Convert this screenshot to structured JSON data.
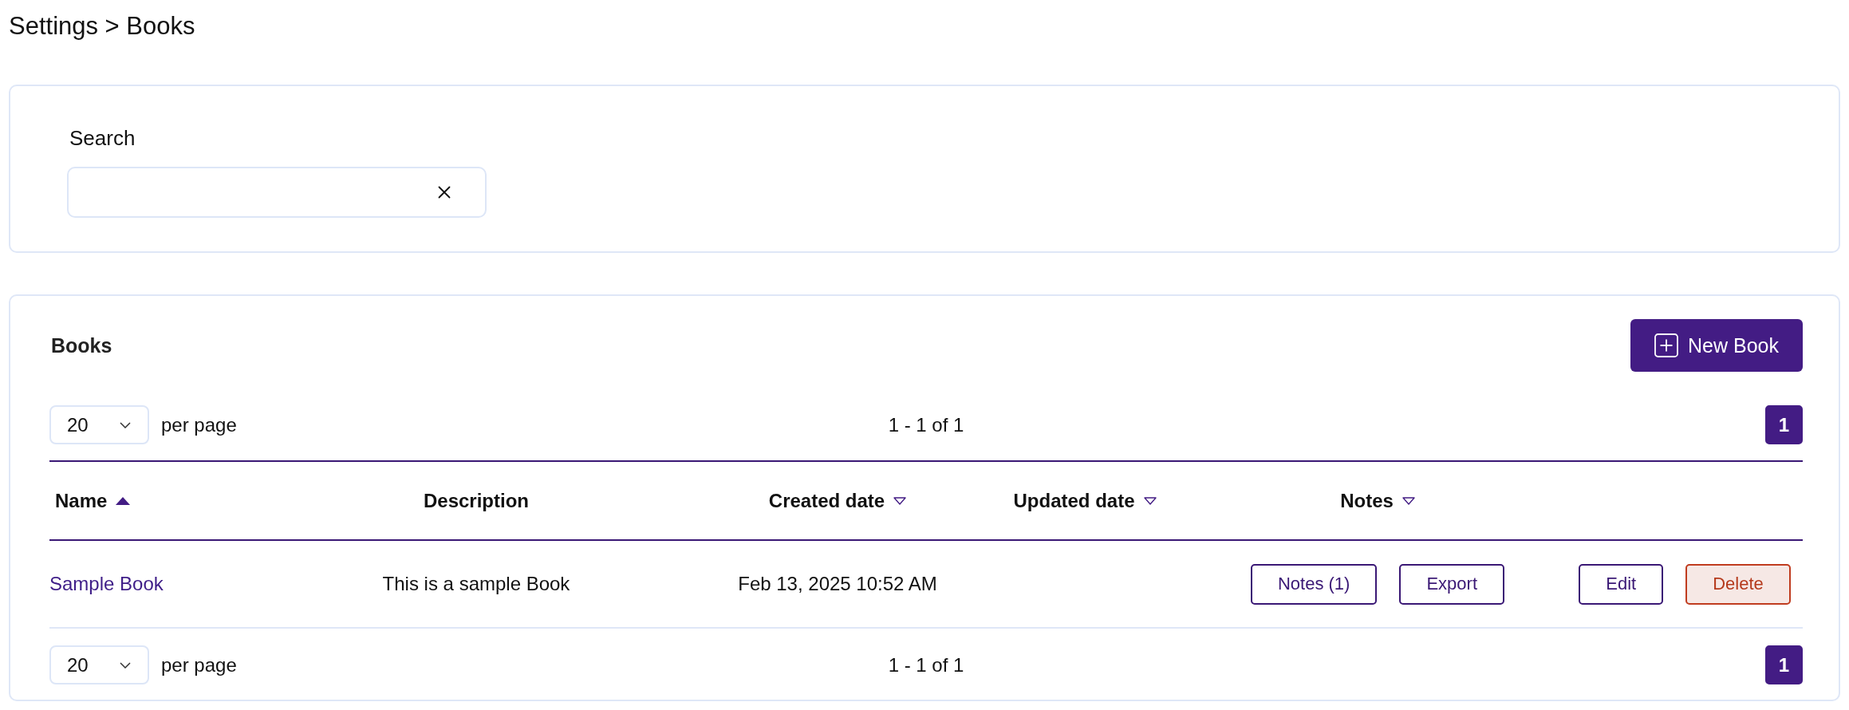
{
  "page_title": "Settings > Books",
  "search": {
    "label": "Search"
  },
  "books": {
    "title": "Books",
    "new_button": "New Book",
    "pagination_top": {
      "per_page": "20",
      "per_page_label": "per page",
      "range": "1 - 1 of 1",
      "pages": [
        {
          "label": "1",
          "selected": true
        }
      ]
    },
    "table": {
      "columns": [
        {
          "label": "Name",
          "sortable": true,
          "sorted": true
        },
        {
          "label": "Description",
          "sortable": false,
          "sorted": false
        },
        {
          "label": "Created date",
          "sortable": true,
          "sorted": false
        },
        {
          "label": "Updated date",
          "sortable": true,
          "sorted": false
        },
        {
          "label": "Notes",
          "sortable": true,
          "sorted": false
        }
      ],
      "rows": [
        {
          "name": "Sample Book",
          "description": "This is a sample Book",
          "created_date": "Feb 13, 2025 10:52 AM",
          "notes_buttons": [
            {
              "label": "Notes (1)",
              "kind": "outline"
            },
            {
              "label": "Export",
              "kind": "outline"
            }
          ],
          "column_6": [
            {
              "label": "Edit",
              "kind": "outline"
            },
            {
              "label": "Delete",
              "kind": "danger"
            }
          ]
        }
      ]
    },
    "pagination_bottom": {
      "per_page": "20",
      "per_page_label": "per page",
      "range": "1 - 1 of 1",
      "pages": [
        {
          "label": "1",
          "selected": true
        }
      ]
    }
  }
}
